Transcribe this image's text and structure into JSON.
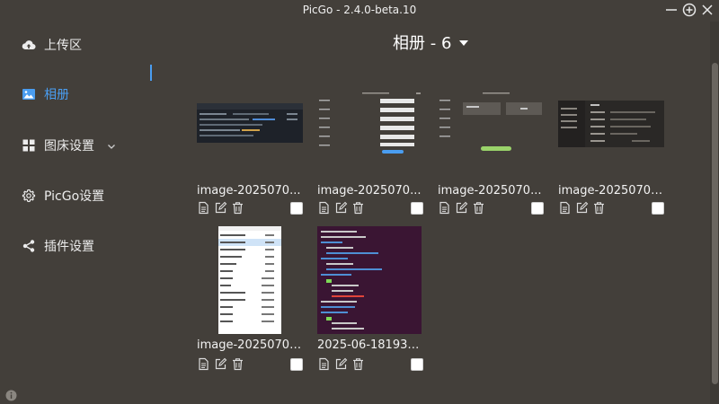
{
  "window": {
    "title": "PicGo - 2.4.0-beta.10"
  },
  "sidebar": {
    "items": [
      {
        "label": "上传区",
        "icon": "cloud-upload-icon"
      },
      {
        "label": "相册",
        "icon": "image-icon",
        "active": true
      },
      {
        "label": "图床设置",
        "icon": "grid-icon",
        "expandable": true
      },
      {
        "label": "PicGo设置",
        "icon": "gear-icon"
      },
      {
        "label": "插件设置",
        "icon": "share-icon"
      }
    ]
  },
  "gallery": {
    "title": "相册 - 6",
    "cards": [
      {
        "name": "image-2025070..."
      },
      {
        "name": "image-2025070..."
      },
      {
        "name": "image-2025070..."
      },
      {
        "name": "image-20250701..."
      },
      {
        "name": "image-20250701..."
      },
      {
        "name": "2025-06-181935..."
      }
    ]
  },
  "colors": {
    "background": "#433f3a",
    "accent": "#4a9df0",
    "text": "#e8e8e8"
  }
}
